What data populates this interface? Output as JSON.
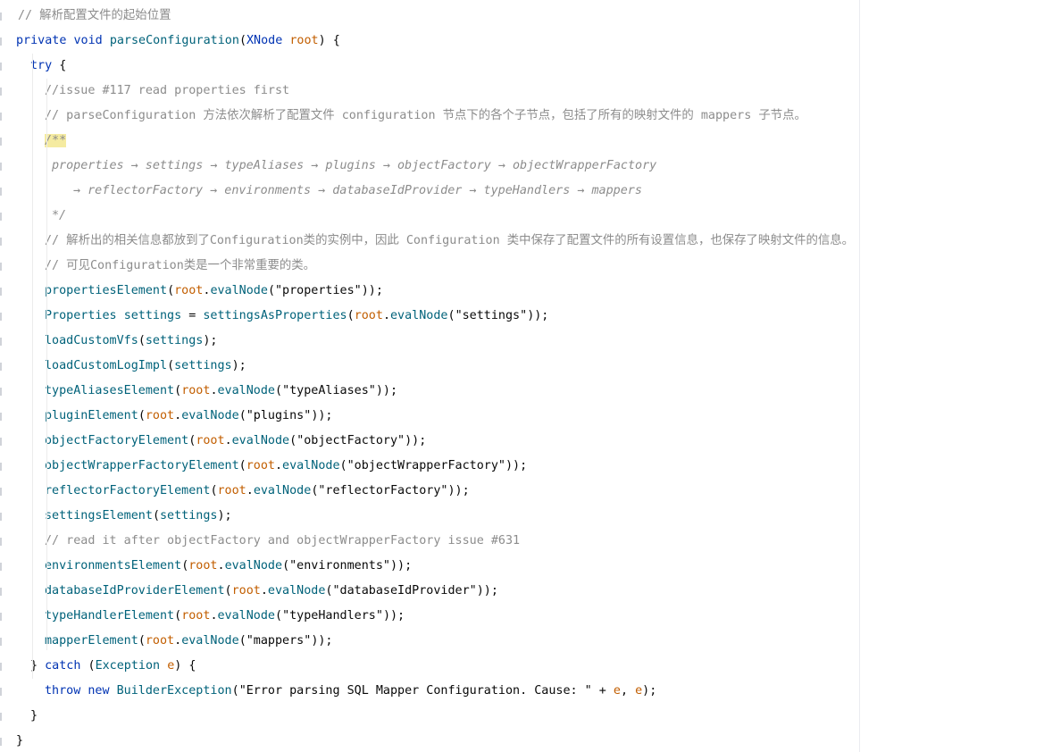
{
  "editor": {
    "lines": [
      {
        "indent": 20,
        "tokens": [
          {
            "t": "// 解析配置文件的起始位置",
            "c": "cmt"
          }
        ]
      },
      {
        "indent": 18,
        "tokens": [
          {
            "t": "private",
            "c": "kw"
          },
          {
            "t": " ",
            "c": "plain"
          },
          {
            "t": "void",
            "c": "kw"
          },
          {
            "t": " ",
            "c": "plain"
          },
          {
            "t": "parseConfiguration",
            "c": "fn"
          },
          {
            "t": "(",
            "c": "plain"
          },
          {
            "t": "XNode",
            "c": "ty"
          },
          {
            "t": " ",
            "c": "plain"
          },
          {
            "t": "root",
            "c": "param"
          },
          {
            "t": ") {",
            "c": "plain"
          }
        ]
      },
      {
        "indent": 34,
        "tokens": [
          {
            "t": "try",
            "c": "kw"
          },
          {
            "t": " {",
            "c": "plain"
          }
        ]
      },
      {
        "indent": 50,
        "tokens": [
          {
            "t": "//issue #117 read properties first",
            "c": "cmt"
          }
        ]
      },
      {
        "indent": 50,
        "tokens": [
          {
            "t": "// parseConfiguration 方法依次解析了配置文件 configuration 节点下的各个子节点，包括了所有的映射文件的 mappers 子节点。",
            "c": "cmt"
          }
        ]
      },
      {
        "indent": 50,
        "tokens": [
          {
            "t": "/**",
            "c": "doc",
            "hl": true
          }
        ]
      },
      {
        "indent": 58,
        "tokens": [
          {
            "t": "properties → settings → typeAliases → plugins → objectFactory → objectWrapperFactory",
            "c": "doc"
          }
        ]
      },
      {
        "indent": 82,
        "tokens": [
          {
            "t": "→ reflectorFactory → environments → databaseIdProvider → typeHandlers → mappers",
            "c": "doc"
          }
        ]
      },
      {
        "indent": 58,
        "tokens": [
          {
            "t": "*/",
            "c": "doc"
          }
        ]
      },
      {
        "indent": 50,
        "tokens": [
          {
            "t": "// 解析出的相关信息都放到了Configuration类的实例中，因此 Configuration 类中保存了配置文件的所有设置信息，也保存了映射文件的信息。",
            "c": "cmt"
          }
        ]
      },
      {
        "indent": 50,
        "tokens": [
          {
            "t": "// 可见Configuration类是一个非常重要的类。",
            "c": "cmt"
          }
        ]
      },
      {
        "indent": 50,
        "tokens": [
          {
            "t": "propertiesElement",
            "c": "method"
          },
          {
            "t": "(",
            "c": "plain"
          },
          {
            "t": "root",
            "c": "param"
          },
          {
            "t": ".",
            "c": "plain"
          },
          {
            "t": "evalNode",
            "c": "method"
          },
          {
            "t": "(",
            "c": "plain"
          },
          {
            "t": "\"properties\"",
            "c": "plain"
          },
          {
            "t": "));",
            "c": "plain"
          }
        ]
      },
      {
        "indent": 50,
        "tokens": [
          {
            "t": "Properties",
            "c": "method"
          },
          {
            "t": " ",
            "c": "plain"
          },
          {
            "t": "settings",
            "c": "method"
          },
          {
            "t": " = ",
            "c": "plain"
          },
          {
            "t": "settingsAsProperties",
            "c": "method"
          },
          {
            "t": "(",
            "c": "plain"
          },
          {
            "t": "root",
            "c": "param"
          },
          {
            "t": ".",
            "c": "plain"
          },
          {
            "t": "evalNode",
            "c": "method"
          },
          {
            "t": "(",
            "c": "plain"
          },
          {
            "t": "\"settings\"",
            "c": "plain"
          },
          {
            "t": "));",
            "c": "plain"
          }
        ]
      },
      {
        "indent": 50,
        "tokens": [
          {
            "t": "loadCustomVfs",
            "c": "method"
          },
          {
            "t": "(",
            "c": "plain"
          },
          {
            "t": "settings",
            "c": "method"
          },
          {
            "t": ");",
            "c": "plain"
          }
        ]
      },
      {
        "indent": 50,
        "tokens": [
          {
            "t": "loadCustomLogImpl",
            "c": "method"
          },
          {
            "t": "(",
            "c": "plain"
          },
          {
            "t": "settings",
            "c": "method"
          },
          {
            "t": ");",
            "c": "plain"
          }
        ]
      },
      {
        "indent": 50,
        "tokens": [
          {
            "t": "typeAliasesElement",
            "c": "method"
          },
          {
            "t": "(",
            "c": "plain"
          },
          {
            "t": "root",
            "c": "param"
          },
          {
            "t": ".",
            "c": "plain"
          },
          {
            "t": "evalNode",
            "c": "method"
          },
          {
            "t": "(",
            "c": "plain"
          },
          {
            "t": "\"typeAliases\"",
            "c": "plain"
          },
          {
            "t": "));",
            "c": "plain"
          }
        ]
      },
      {
        "indent": 50,
        "tokens": [
          {
            "t": "pluginElement",
            "c": "method"
          },
          {
            "t": "(",
            "c": "plain"
          },
          {
            "t": "root",
            "c": "param"
          },
          {
            "t": ".",
            "c": "plain"
          },
          {
            "t": "evalNode",
            "c": "method"
          },
          {
            "t": "(",
            "c": "plain"
          },
          {
            "t": "\"plugins\"",
            "c": "plain"
          },
          {
            "t": "));",
            "c": "plain"
          }
        ]
      },
      {
        "indent": 50,
        "tokens": [
          {
            "t": "objectFactoryElement",
            "c": "method"
          },
          {
            "t": "(",
            "c": "plain"
          },
          {
            "t": "root",
            "c": "param"
          },
          {
            "t": ".",
            "c": "plain"
          },
          {
            "t": "evalNode",
            "c": "method"
          },
          {
            "t": "(",
            "c": "plain"
          },
          {
            "t": "\"objectFactory\"",
            "c": "plain"
          },
          {
            "t": "));",
            "c": "plain"
          }
        ]
      },
      {
        "indent": 50,
        "tokens": [
          {
            "t": "objectWrapperFactoryElement",
            "c": "method"
          },
          {
            "t": "(",
            "c": "plain"
          },
          {
            "t": "root",
            "c": "param"
          },
          {
            "t": ".",
            "c": "plain"
          },
          {
            "t": "evalNode",
            "c": "method"
          },
          {
            "t": "(",
            "c": "plain"
          },
          {
            "t": "\"objectWrapperFactory\"",
            "c": "plain"
          },
          {
            "t": "));",
            "c": "plain"
          }
        ]
      },
      {
        "indent": 50,
        "tokens": [
          {
            "t": "reflectorFactoryElement",
            "c": "method"
          },
          {
            "t": "(",
            "c": "plain"
          },
          {
            "t": "root",
            "c": "param"
          },
          {
            "t": ".",
            "c": "plain"
          },
          {
            "t": "evalNode",
            "c": "method"
          },
          {
            "t": "(",
            "c": "plain"
          },
          {
            "t": "\"reflectorFactory\"",
            "c": "plain"
          },
          {
            "t": "));",
            "c": "plain"
          }
        ]
      },
      {
        "indent": 50,
        "tokens": [
          {
            "t": "settingsElement",
            "c": "method"
          },
          {
            "t": "(",
            "c": "plain"
          },
          {
            "t": "settings",
            "c": "method"
          },
          {
            "t": ");",
            "c": "plain"
          }
        ]
      },
      {
        "indent": 50,
        "tokens": [
          {
            "t": "// read it after objectFactory and objectWrapperFactory issue #631",
            "c": "cmt"
          }
        ]
      },
      {
        "indent": 50,
        "tokens": [
          {
            "t": "environmentsElement",
            "c": "method"
          },
          {
            "t": "(",
            "c": "plain"
          },
          {
            "t": "root",
            "c": "param"
          },
          {
            "t": ".",
            "c": "plain"
          },
          {
            "t": "evalNode",
            "c": "method"
          },
          {
            "t": "(",
            "c": "plain"
          },
          {
            "t": "\"environments\"",
            "c": "plain"
          },
          {
            "t": "));",
            "c": "plain"
          }
        ]
      },
      {
        "indent": 50,
        "tokens": [
          {
            "t": "databaseIdProviderElement",
            "c": "method"
          },
          {
            "t": "(",
            "c": "plain"
          },
          {
            "t": "root",
            "c": "param"
          },
          {
            "t": ".",
            "c": "plain"
          },
          {
            "t": "evalNode",
            "c": "method"
          },
          {
            "t": "(",
            "c": "plain"
          },
          {
            "t": "\"databaseIdProvider\"",
            "c": "plain"
          },
          {
            "t": "));",
            "c": "plain"
          }
        ]
      },
      {
        "indent": 50,
        "tokens": [
          {
            "t": "typeHandlerElement",
            "c": "method"
          },
          {
            "t": "(",
            "c": "plain"
          },
          {
            "t": "root",
            "c": "param"
          },
          {
            "t": ".",
            "c": "plain"
          },
          {
            "t": "evalNode",
            "c": "method"
          },
          {
            "t": "(",
            "c": "plain"
          },
          {
            "t": "\"typeHandlers\"",
            "c": "plain"
          },
          {
            "t": "));",
            "c": "plain"
          }
        ]
      },
      {
        "indent": 50,
        "tokens": [
          {
            "t": "mapperElement",
            "c": "method"
          },
          {
            "t": "(",
            "c": "plain"
          },
          {
            "t": "root",
            "c": "param"
          },
          {
            "t": ".",
            "c": "plain"
          },
          {
            "t": "evalNode",
            "c": "method"
          },
          {
            "t": "(",
            "c": "plain"
          },
          {
            "t": "\"mappers\"",
            "c": "plain"
          },
          {
            "t": "));",
            "c": "plain"
          }
        ]
      },
      {
        "indent": 34,
        "tokens": [
          {
            "t": "} ",
            "c": "plain"
          },
          {
            "t": "catch",
            "c": "kw"
          },
          {
            "t": " (",
            "c": "plain"
          },
          {
            "t": "Exception",
            "c": "method"
          },
          {
            "t": " ",
            "c": "plain"
          },
          {
            "t": "e",
            "c": "param"
          },
          {
            "t": ") {",
            "c": "plain"
          }
        ]
      },
      {
        "indent": 50,
        "tokens": [
          {
            "t": "throw",
            "c": "kw"
          },
          {
            "t": " ",
            "c": "plain"
          },
          {
            "t": "new",
            "c": "kw"
          },
          {
            "t": " ",
            "c": "plain"
          },
          {
            "t": "BuilderException",
            "c": "method"
          },
          {
            "t": "(",
            "c": "plain"
          },
          {
            "t": "\"Error parsing SQL Mapper Configuration. Cause: \"",
            "c": "plain"
          },
          {
            "t": " + ",
            "c": "plain"
          },
          {
            "t": "e",
            "c": "param"
          },
          {
            "t": ", ",
            "c": "plain"
          },
          {
            "t": "e",
            "c": "param"
          },
          {
            "t": ");",
            "c": "plain"
          }
        ]
      },
      {
        "indent": 34,
        "tokens": [
          {
            "t": "}",
            "c": "plain"
          }
        ]
      },
      {
        "indent": 18,
        "tokens": [
          {
            "t": "}",
            "c": "plain"
          }
        ]
      }
    ]
  },
  "colors": {
    "keyword": "#0033b3",
    "method": "#00627a",
    "parameter": "#c25e00",
    "string": "#067d17",
    "comment": "#8c8c8c",
    "doc_highlight": "#f5eba1",
    "background": "#ffffff"
  }
}
